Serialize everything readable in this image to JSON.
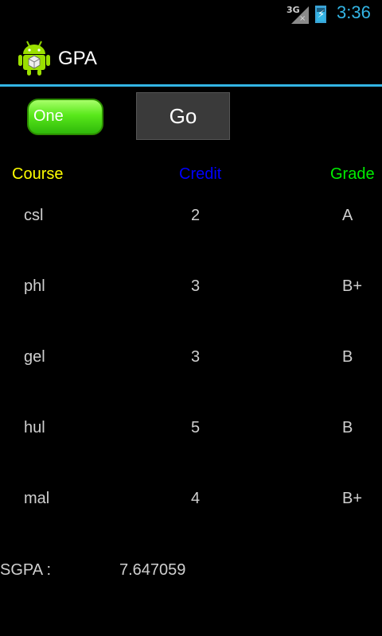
{
  "status": {
    "network": "3G",
    "time": "3:36"
  },
  "app": {
    "title": "GPA"
  },
  "controls": {
    "semester_selected": "One",
    "go_label": "Go"
  },
  "table": {
    "headers": {
      "course": "Course",
      "credit": "Credit",
      "grade": "Grade"
    },
    "rows": [
      {
        "course": "csl",
        "credit": "2",
        "grade": "A"
      },
      {
        "course": "phl",
        "credit": "3",
        "grade": "B+"
      },
      {
        "course": "gel",
        "credit": "3",
        "grade": "B"
      },
      {
        "course": "hul",
        "credit": "5",
        "grade": "B"
      },
      {
        "course": "mal",
        "credit": "4",
        "grade": "B+"
      }
    ]
  },
  "result": {
    "label": "SGPA :",
    "value": "7.647059"
  },
  "colors": {
    "accent": "#33b5e5",
    "course_header": "#ffff00",
    "credit_header": "#0000ff",
    "grade_header": "#00ee00",
    "spinner_green": "#58e81a"
  }
}
